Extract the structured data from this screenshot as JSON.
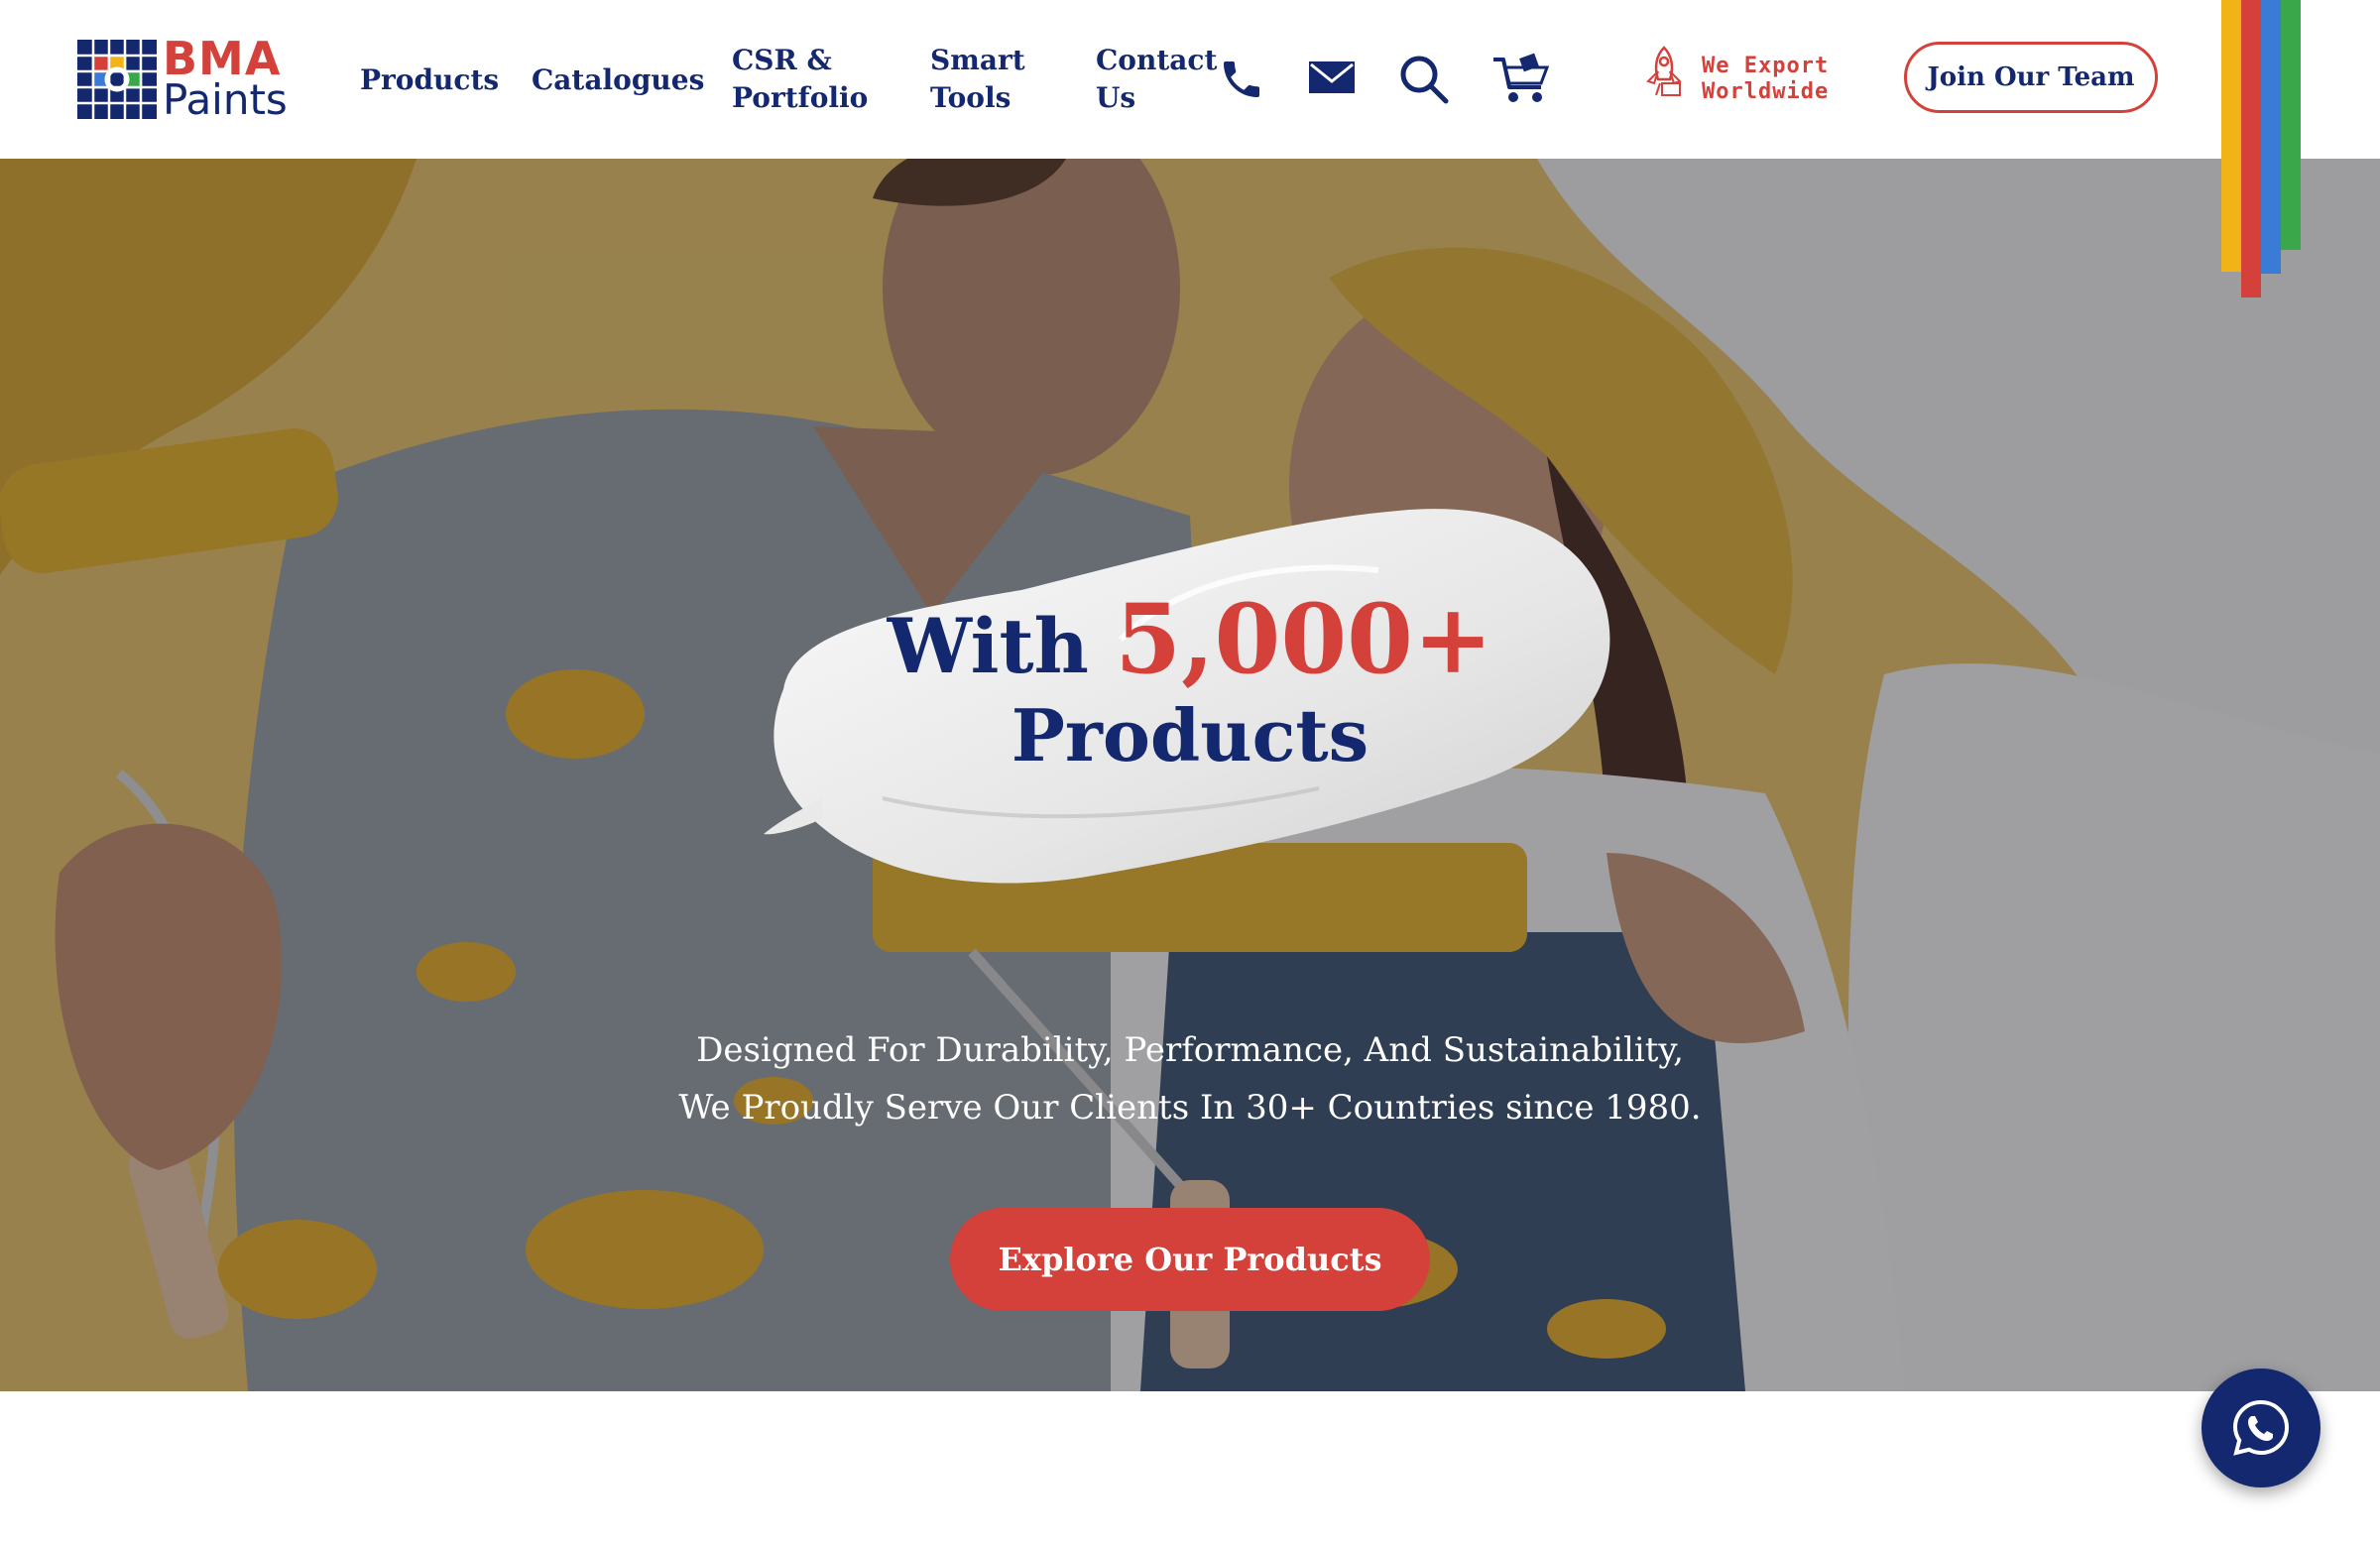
{
  "brand": {
    "line1": "BMA",
    "line2": "Paints",
    "colors": {
      "red": "#d4403a",
      "navy": "#13286e",
      "yellow": "#f2b316",
      "blue": "#3a7bd5",
      "green": "#3aa84a"
    }
  },
  "nav": {
    "products": "Products",
    "catalogues": "Catalogues",
    "csr_line1": "CSR &",
    "csr_line2": "Portfolio",
    "smart_line1": "Smart",
    "smart_line2": "Tools",
    "contact_line1": "Contact",
    "contact_line2": "Us"
  },
  "header_icons": [
    "phone-icon",
    "mail-icon",
    "search-icon",
    "cart-icon"
  ],
  "export": {
    "line1": "We Export",
    "line2": "Worldwide",
    "icon": "rocket-icon"
  },
  "join_button": "Join Our Team",
  "hero": {
    "prefix": "With",
    "number": "5,000+",
    "line2": "Products",
    "tagline_line1": "Designed For Durability, Performance, And Sustainability,",
    "tagline_line2": "We Proudly Serve Our Clients In 30+ Countries since 1980.",
    "cta": "Explore Our Products"
  },
  "floating": {
    "icon": "whatsapp-icon"
  }
}
